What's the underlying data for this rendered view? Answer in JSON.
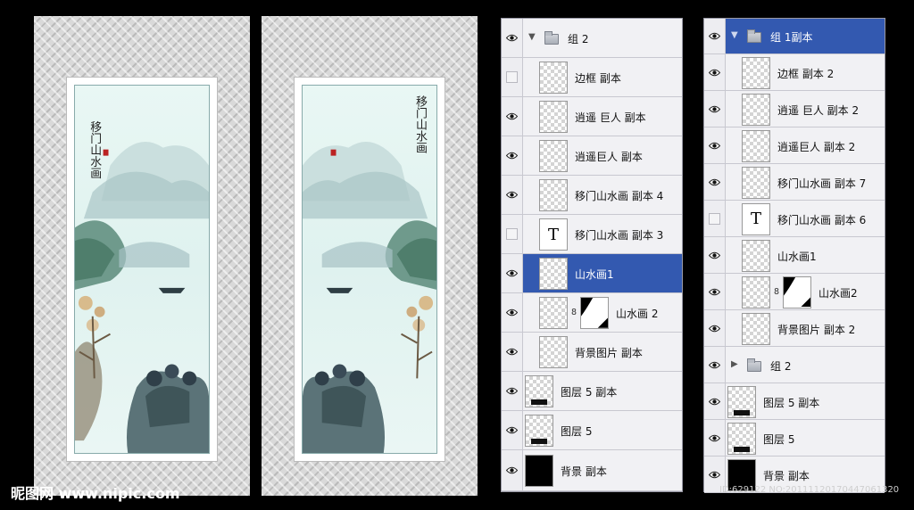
{
  "watermark": {
    "text": "昵图网 www.nipic.com"
  },
  "footer_id": {
    "text": "ID:629122 NO:20111120170447061320"
  },
  "painting": {
    "calligraphy": "移门山水画"
  },
  "panel_1": {
    "layers": [
      {
        "label": "组 2",
        "kind": "group",
        "eye": true,
        "expanded": true
      },
      {
        "label": "边框 副本",
        "kind": "pixel",
        "eye": false,
        "indent": true
      },
      {
        "label": "逍遥 巨人 副本",
        "kind": "pixel",
        "eye": true,
        "indent": true
      },
      {
        "label": "逍遥巨人 副本",
        "kind": "pixel",
        "eye": true,
        "indent": true
      },
      {
        "label": "移门山水画 副本 4",
        "kind": "pixel",
        "eye": true,
        "indent": true
      },
      {
        "label": "移门山水画 副本 3",
        "kind": "type",
        "eye": false,
        "indent": true
      },
      {
        "label": "山水画1",
        "kind": "pixel",
        "eye": true,
        "indent": true,
        "selected": true
      },
      {
        "label": "山水画 2",
        "kind": "masked",
        "eye": true,
        "indent": true
      },
      {
        "label": "背景图片 副本",
        "kind": "pixel",
        "eye": true,
        "indent": true
      },
      {
        "label": "图层 5 副本",
        "kind": "pixel-dark",
        "eye": true
      },
      {
        "label": "图层 5",
        "kind": "pixel-dark",
        "eye": true
      },
      {
        "label": "背景 副本",
        "kind": "black",
        "eye": true
      }
    ]
  },
  "panel_2": {
    "layers": [
      {
        "label": "组 1副本",
        "kind": "group",
        "eye": true,
        "expanded": true,
        "selected": true
      },
      {
        "label": "边框 副本 2",
        "kind": "pixel",
        "eye": true,
        "indent": true
      },
      {
        "label": "逍遥 巨人 副本 2",
        "kind": "pixel",
        "eye": true,
        "indent": true
      },
      {
        "label": "逍遥巨人 副本 2",
        "kind": "pixel",
        "eye": true,
        "indent": true
      },
      {
        "label": "移门山水画 副本 7",
        "kind": "pixel",
        "eye": true,
        "indent": true
      },
      {
        "label": "移门山水画 副本 6",
        "kind": "type",
        "eye": false,
        "indent": true
      },
      {
        "label": "山水画1",
        "kind": "pixel",
        "eye": true,
        "indent": true
      },
      {
        "label": "山水画2",
        "kind": "masked",
        "eye": true,
        "indent": true
      },
      {
        "label": "背景图片 副本 2",
        "kind": "pixel",
        "eye": true,
        "indent": true
      },
      {
        "label": "组 2",
        "kind": "group",
        "eye": true,
        "expanded": false
      },
      {
        "label": "图层 5 副本",
        "kind": "pixel-dark",
        "eye": true
      },
      {
        "label": "图层 5",
        "kind": "pixel-dark",
        "eye": true
      },
      {
        "label": "背景 副本",
        "kind": "black",
        "eye": true
      }
    ]
  },
  "colors": {
    "selection": "#3359b0",
    "panel_bg": "#e8e8ec",
    "painting_sky": "#e6f5f2",
    "mountain": "#8aa5a6"
  }
}
